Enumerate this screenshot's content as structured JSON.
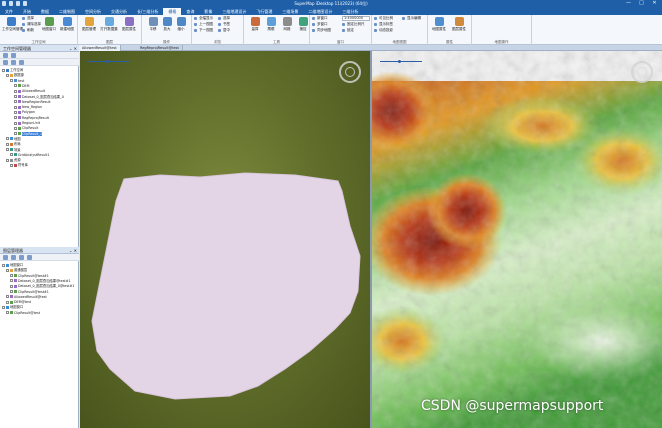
{
  "window": {
    "title": "SuperMap iDesktop 11i(2023) (64位)",
    "controls": [
      "—",
      "□",
      "✕"
    ]
  },
  "menu": {
    "items": [
      "文件",
      "开始",
      "数据",
      "二维制图",
      "空间分析",
      "交通分析",
      "长/三维分析",
      "栅格",
      "查询",
      "影像",
      "三维地理设计",
      "飞行管理",
      "三维场景",
      "二维地图设计",
      "三维分析"
    ],
    "active_index": 7
  },
  "ribbon": {
    "groups": {
      "workspace": "工作空间",
      "layers": "图层",
      "operate": "操作",
      "browse": "浏览",
      "tools": "工具",
      "window": "窗口",
      "map_view": "地图视图",
      "properties": "属性",
      "map_actions": "地图操作"
    },
    "buttons": {
      "workspace_manager": "工作空间管理",
      "save_workspace": "保存",
      "map_window": "地图窗口",
      "open_dataset": "打开数据集",
      "new_map": "新建地图",
      "layer_manage": "图层管理",
      "layer_attr": "图层属性",
      "pan": "平移",
      "zoom_in": "放大",
      "zoom_out": "缩小",
      "full_extent": "全幅显示",
      "select": "选择",
      "bookmark": "书签",
      "measure": "量算",
      "overview": "鹰眼",
      "grid": "网格",
      "new_window": "新窗口",
      "multi_map": "多窗口",
      "sync": "同步地图",
      "lock": "锁定",
      "map_property": "地图属性",
      "layer_property": "图层属性",
      "snap": "捕捉",
      "dynamic": "动态投影",
      "fix_scale": "固定比例尺",
      "display_edit": "显示编辑"
    },
    "small": {
      "select_all": "选择",
      "clear": "清除选择",
      "refresh": "刷新",
      "zoom_prev": "上一视图",
      "zoom_next": "下一视图",
      "center": "居中"
    },
    "scale_value": "1:4000000",
    "visible_scale": "可见比例",
    "show_label": "显示标签"
  },
  "workspace_panel": {
    "title": "工作空间管理器",
    "controls": "⌄ ✕",
    "tree": [
      {
        "label": "工作空间",
        "depth": 0,
        "icon": "workspace-icon"
      },
      {
        "label": "数据源",
        "depth": 1,
        "icon": "datasources-icon"
      },
      {
        "label": "test",
        "depth": 2,
        "icon": "datasource-icon"
      },
      {
        "label": "DEM",
        "depth": 3,
        "icon": "grid-dataset-icon"
      },
      {
        "label": "AllowedResult",
        "depth": 3,
        "icon": "region-dataset-icon"
      },
      {
        "label": "Dataset_0_图层叠加结果_0",
        "depth": 3,
        "icon": "region-dataset-icon"
      },
      {
        "label": "NewRegionResult",
        "depth": 3,
        "icon": "region-dataset-icon"
      },
      {
        "label": "New_Region",
        "depth": 3,
        "icon": "region-dataset-icon"
      },
      {
        "label": "Polygon",
        "depth": 3,
        "icon": "region-dataset-icon"
      },
      {
        "label": "RegReprojResult",
        "depth": 3,
        "icon": "region-dataset-icon"
      },
      {
        "label": "RegionUnit",
        "depth": 3,
        "icon": "region-dataset-icon"
      },
      {
        "label": "ClipResult",
        "depth": 3,
        "icon": "grid-dataset-icon"
      },
      {
        "label": "ClipResult_1",
        "depth": 3,
        "icon": "grid-dataset-icon",
        "selected": true
      },
      {
        "label": "地图",
        "depth": 1,
        "icon": "maps-icon"
      },
      {
        "label": "布局",
        "depth": 1,
        "icon": "layouts-icon"
      },
      {
        "label": "场景",
        "depth": 1,
        "icon": "scenes-icon"
      },
      {
        "label": "GridAnalystResult1",
        "depth": 2,
        "icon": "scene-icon"
      },
      {
        "label": "资源",
        "depth": 1,
        "icon": "resources-icon"
      },
      {
        "label": "符号库",
        "depth": 2,
        "icon": "symbol-icon"
      }
    ]
  },
  "layer_panel": {
    "title": "图层管理器",
    "controls": "⌄ ✕",
    "tree": [
      {
        "label": "地图窗口",
        "depth": 0,
        "icon": "map-window-icon"
      },
      {
        "label": "普通图层",
        "depth": 1,
        "icon": "layer-group-icon"
      },
      {
        "label": "ClipResult@test#1",
        "depth": 2,
        "icon": "grid-layer-icon"
      },
      {
        "label": "Dataset_0_图层叠加结果@test#1",
        "depth": 2,
        "icon": "region-layer-icon"
      },
      {
        "label": "Dataset_0_图层叠加结果_0@test#1",
        "depth": 2,
        "icon": "region-layer-icon"
      },
      {
        "label": "ClipResult@test#1",
        "depth": 2,
        "icon": "grid-layer-icon"
      },
      {
        "label": "AllowedResult@test",
        "depth": 1,
        "icon": "region-layer-icon"
      },
      {
        "label": "DEM@test",
        "depth": 1,
        "icon": "grid-layer-icon"
      },
      {
        "label": "地图窗口",
        "depth": 0,
        "icon": "map-window-icon"
      },
      {
        "label": "ClipResult@test",
        "depth": 1,
        "icon": "grid-layer-icon"
      }
    ]
  },
  "tabs": [
    {
      "label": "AllowedResult@test",
      "active": true
    },
    {
      "label": "RegReprojResult@test",
      "active": false
    }
  ],
  "colors": {
    "title_bar": "#1e5fa8",
    "polygon_fill": "#e4d5e6",
    "dem_low": "#c8e8b8",
    "dem_high": "#8b1a0e"
  },
  "watermark": "CSDN @supermapsupport"
}
